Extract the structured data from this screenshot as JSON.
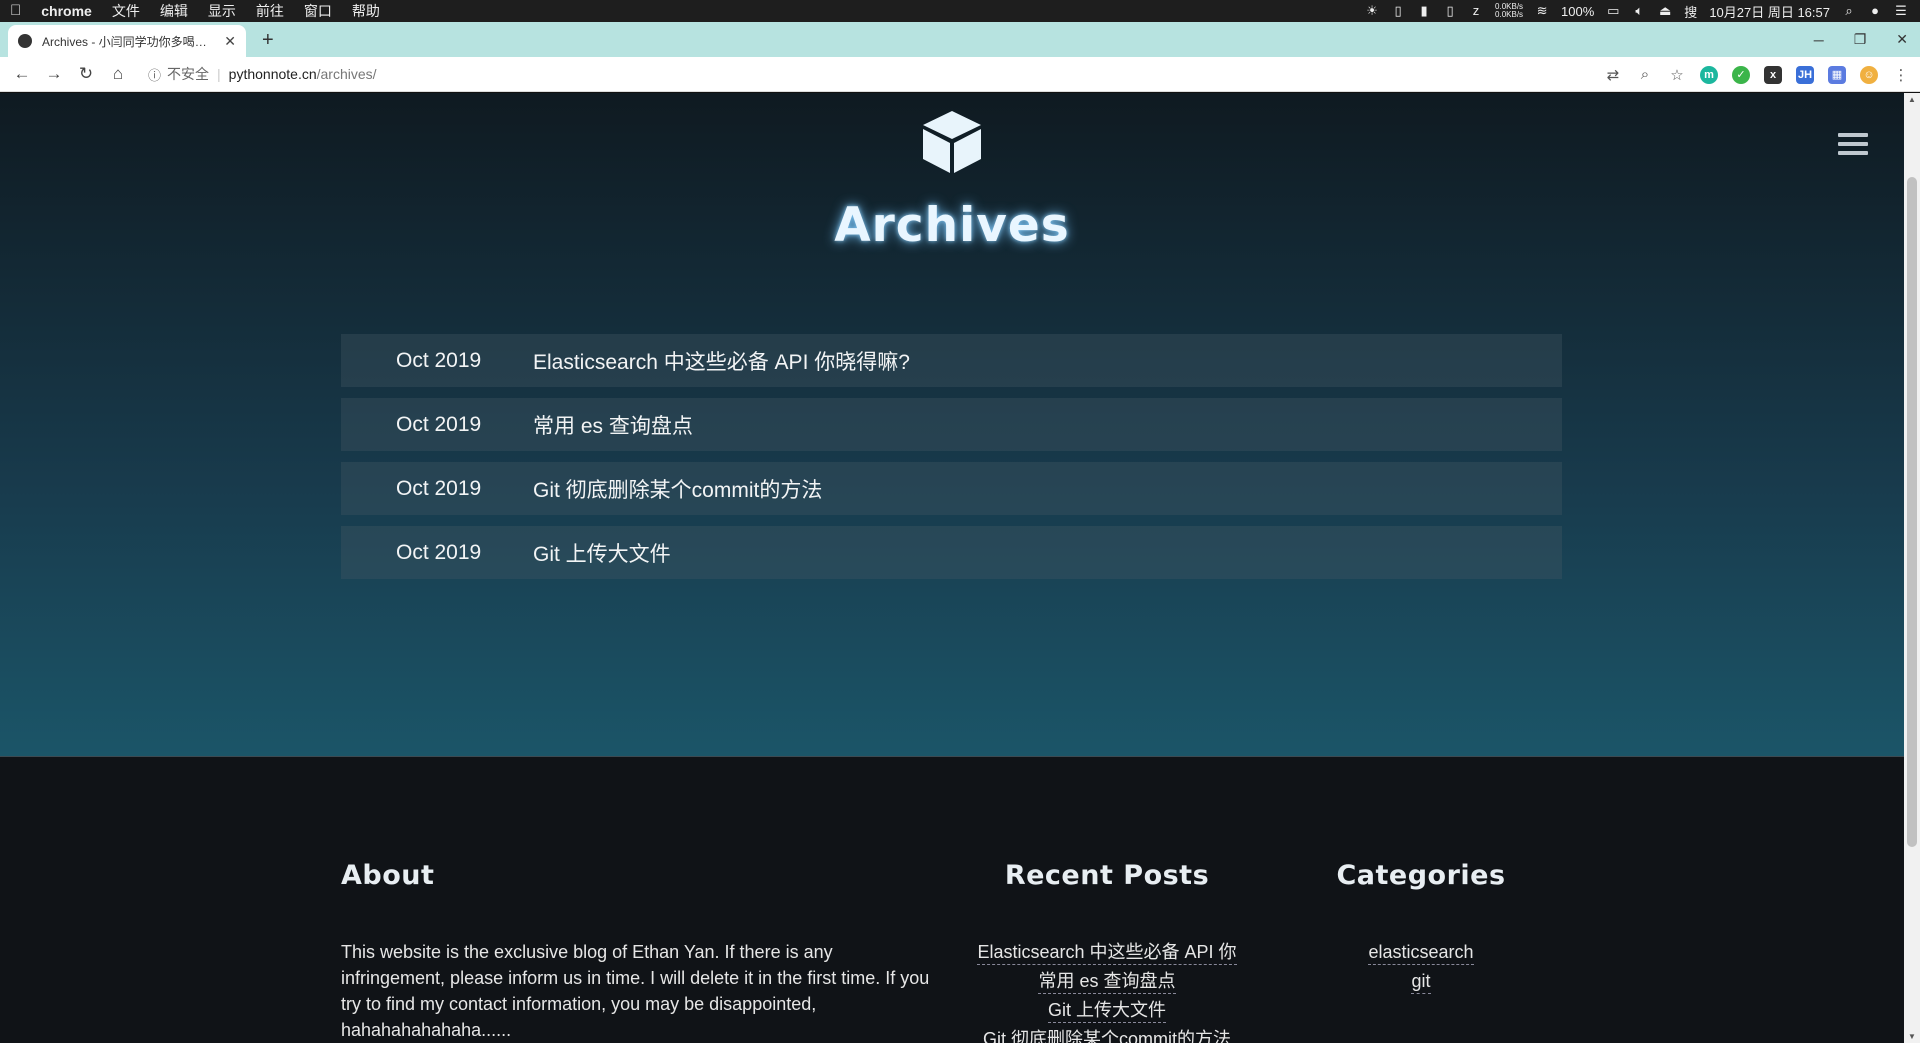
{
  "macbar": {
    "app_name": "chrome",
    "menus": [
      "文件",
      "编辑",
      "显示",
      "前往",
      "窗口",
      "帮助"
    ],
    "net_up": "0.0KB/s",
    "net_down": "0.0KB/s",
    "battery": "100%",
    "input_method": "搜",
    "clock": "10月27日 周日 16:57"
  },
  "browser": {
    "tab_title": "Archives - 小闫同学功你多喝热水",
    "url_insecure_label": "不安全",
    "url_host": "pythonnote.cn",
    "url_path": "/archives/"
  },
  "page": {
    "title": "Archives",
    "archives": [
      {
        "date": "Oct 2019",
        "title": "Elasticsearch 中这些必备 API 你晓得嘛?"
      },
      {
        "date": "Oct 2019",
        "title": "常用 es 查询盘点"
      },
      {
        "date": "Oct 2019",
        "title": "Git 彻底删除某个commit的方法"
      },
      {
        "date": "Oct 2019",
        "title": "Git 上传大文件"
      }
    ]
  },
  "footer": {
    "about_heading": "About",
    "about_text": "This website is the exclusive blog of Ethan Yan. If there is any infringement, please inform us in time. I will delete it in the first time. If you try to find my contact information, you may be disappointed, hahahahahahaha......",
    "recent_heading": "Recent Posts",
    "recent_posts": [
      "Elasticsearch 中这些必备 API 你",
      "常用 es 查询盘点",
      "Git 上传大文件",
      "Git 彻底删除某个commit的方法"
    ],
    "categories_heading": "Categories",
    "categories": [
      "elasticsearch",
      "git"
    ]
  },
  "colors": {
    "hero_top": "#0f1a21",
    "hero_bottom": "#1b5568",
    "footer_bg": "#101317",
    "tabstrip": "#b7e3e0"
  }
}
